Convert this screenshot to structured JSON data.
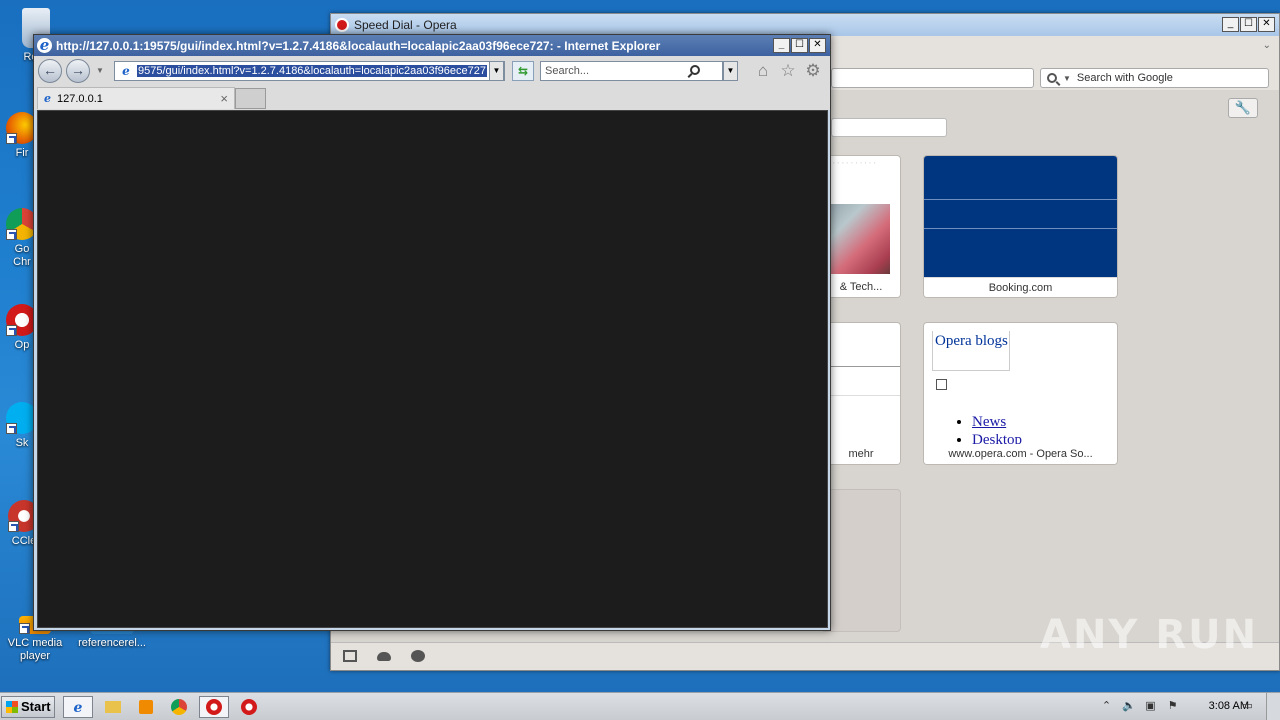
{
  "desktop": {
    "icons": [
      {
        "label": "Recy",
        "color": "#9fb7d0"
      },
      {
        "label": "Fir",
        "color": "#e66000"
      },
      {
        "label": "Go\nChr",
        "color": "#4285f4"
      },
      {
        "label": "Op",
        "color": "#d21a1a"
      },
      {
        "label": "Sk",
        "color": "#00aff0"
      },
      {
        "label": "CCle",
        "color": "#c8352b"
      },
      {
        "label": "VLC media player",
        "color": "#f08a00"
      },
      {
        "label": "referencerel...",
        "color": "#2a8ad6"
      }
    ],
    "watermark": "ANY RUN"
  },
  "opera": {
    "title": "Speed Dial - Opera",
    "search_placeholder": "Search with Google",
    "tiles": [
      {
        "caption": "& Tech..."
      },
      {
        "caption": "Booking.com"
      },
      {
        "caption": "mehr"
      },
      {
        "caption": "www.opera.com - Opera So..."
      }
    ],
    "blogs": {
      "heading": "Opera blogs",
      "links": [
        "News",
        "Desktop"
      ]
    },
    "brand_color": "#003580"
  },
  "ie": {
    "title": "http://127.0.0.1:19575/gui/index.html?v=1.2.7.4186&localauth=localapic2aa03f96ece727: - Internet Explorer",
    "address": "9575/gui/index.html?v=1.2.7.4186&localauth=localapic2aa03f96ece727:",
    "search_placeholder": "Search...",
    "tab_label": "127.0.0.1"
  },
  "taskbar": {
    "start_label": "Start",
    "clock": "3:08 AM"
  }
}
